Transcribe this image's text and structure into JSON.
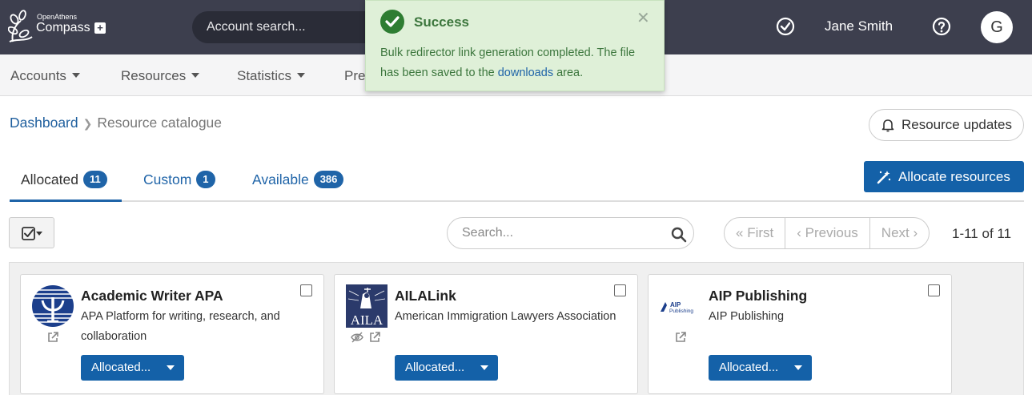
{
  "header": {
    "brand_small": "OpenAthens",
    "brand_big": "Compass",
    "account_search_placeholder": "Account search...",
    "user_name": "Jane Smith",
    "avatar_initial": "G"
  },
  "nav": {
    "items": [
      {
        "label": "Accounts"
      },
      {
        "label": "Resources"
      },
      {
        "label": "Statistics"
      },
      {
        "label": "Pre"
      }
    ]
  },
  "toast": {
    "title": "Success",
    "message_before": "Bulk redirector link generation completed. The file has been saved to the ",
    "link_text": "downloads",
    "message_after": " area."
  },
  "breadcrumb": {
    "dashboard": "Dashboard",
    "current": "Resource catalogue"
  },
  "resource_updates_label": "Resource updates",
  "tabs": [
    {
      "label": "Allocated",
      "count": "11"
    },
    {
      "label": "Custom",
      "count": "1"
    },
    {
      "label": "Available",
      "count": "386"
    }
  ],
  "allocate_button": "Allocate resources",
  "search_placeholder": "Search...",
  "pager": {
    "first": "First",
    "previous": "Previous",
    "next": "Next",
    "count": "1-11 of 11"
  },
  "cards": [
    {
      "title": "Academic Writer APA",
      "description": "APA Platform for writing, research, and collaboration",
      "button": "Allocated...",
      "logo_icon": "apa-logo"
    },
    {
      "title": "AILALink",
      "description": "American Immigration Lawyers Association",
      "button": "Allocated...",
      "logo_icon": "aila-logo",
      "logo_text": "AILA"
    },
    {
      "title": "AIP Publishing",
      "description": "AIP Publishing",
      "button": "Allocated...",
      "logo_icon": "aip-logo",
      "logo_text": "AIP Publishing"
    }
  ],
  "colors": {
    "topbar": "#3d3f4e",
    "primary": "#1461a8",
    "toast_bg": "#dff0d8",
    "toast_text": "#3c763d"
  }
}
